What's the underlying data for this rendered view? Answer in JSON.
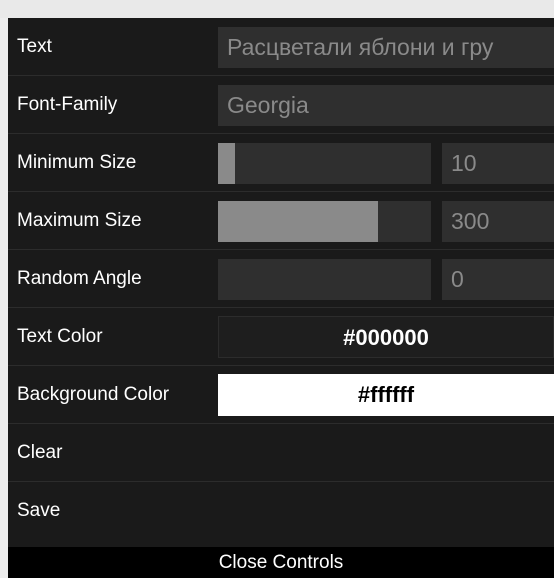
{
  "controls": {
    "text": {
      "label": "Text",
      "value": "Расцветали яблони и гру"
    },
    "font_family": {
      "label": "Font-Family",
      "value": "Georgia"
    },
    "min_size": {
      "label": "Minimum Size",
      "value": "10",
      "fill_fraction": 0.08
    },
    "max_size": {
      "label": "Maximum Size",
      "value": "300",
      "fill_fraction": 0.75
    },
    "random_angle": {
      "label": "Random Angle",
      "value": "0",
      "fill_fraction": 0
    },
    "text_color": {
      "label": "Text Color",
      "value": "#000000",
      "swatch": "#1e1e1e"
    },
    "background_color": {
      "label": "Background Color",
      "value": "#ffffff",
      "swatch": "#ffffff"
    },
    "clear": {
      "label": "Clear"
    },
    "save": {
      "label": "Save"
    }
  },
  "close_controls": {
    "label": "Close Controls"
  },
  "colors": {
    "panel_bg": "#1a1a1a",
    "field_bg": "#2f2f2f",
    "slider_fill": "#8a8a8a",
    "field_text": "#8a8a8a",
    "label_text": "#ffffff"
  }
}
